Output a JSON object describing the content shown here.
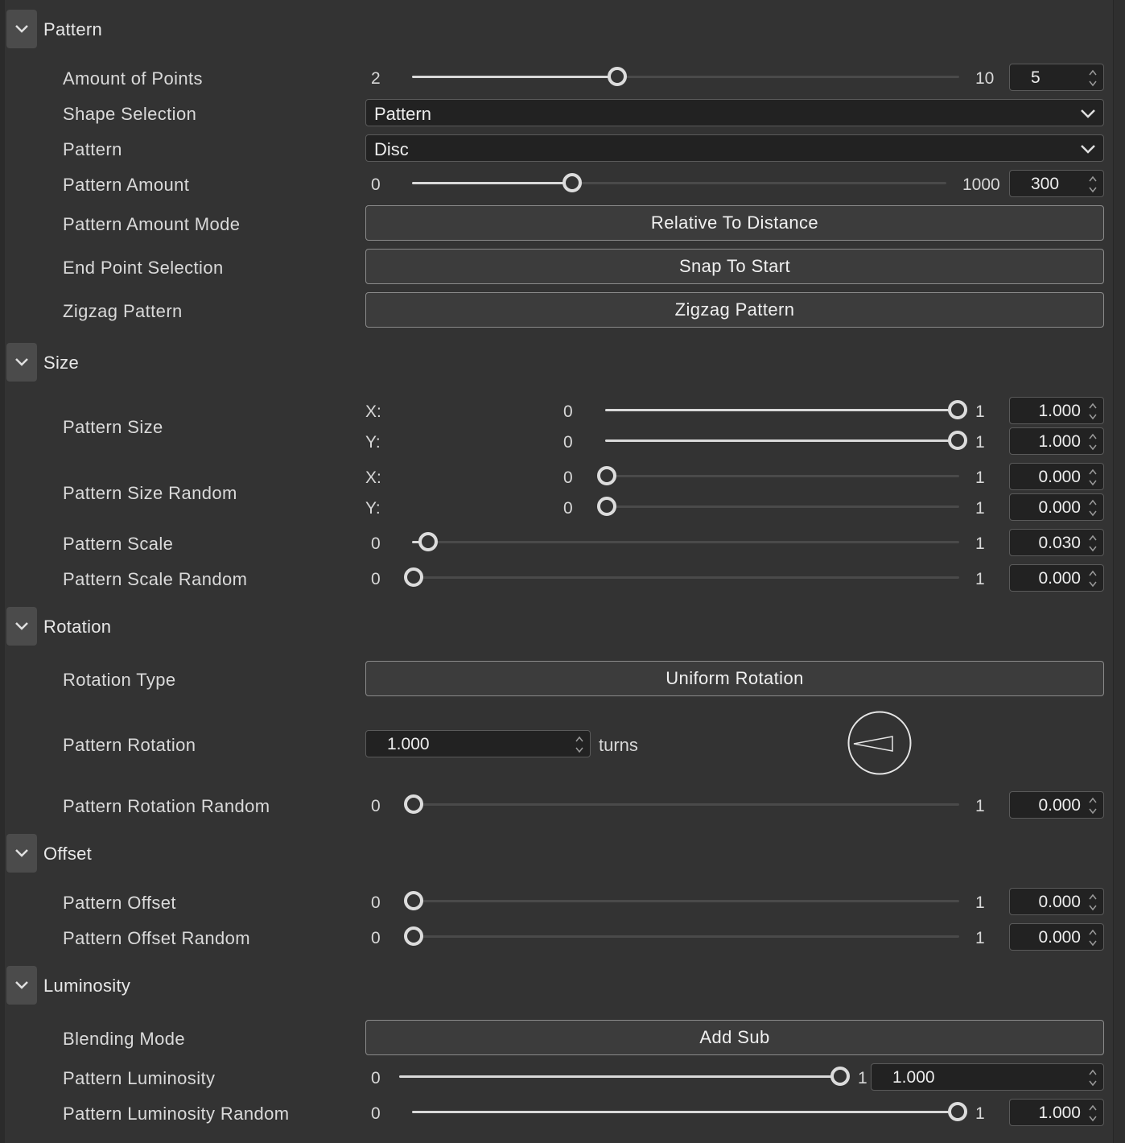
{
  "sections": {
    "pattern": {
      "title": "Pattern",
      "amount_of_points": {
        "label": "Amount of Points",
        "min": "2",
        "max": "10",
        "value": "5",
        "fraction": 0.375
      },
      "shape_selection": {
        "label": "Shape Selection",
        "value": "Pattern"
      },
      "pattern": {
        "label": "Pattern",
        "value": "Disc"
      },
      "pattern_amount": {
        "label": "Pattern Amount",
        "min": "0",
        "max": "1000",
        "value": "300",
        "fraction": 0.3
      },
      "pattern_amount_mode": {
        "label": "Pattern Amount Mode",
        "value": "Relative To Distance"
      },
      "end_point_selection": {
        "label": "End Point Selection",
        "value": "Snap To Start"
      },
      "zigzag_pattern": {
        "label": "Zigzag Pattern",
        "value": "Zigzag Pattern"
      }
    },
    "size": {
      "title": "Size",
      "pattern_size": {
        "label": "Pattern Size",
        "x": {
          "axis": "X:",
          "min": "0",
          "max": "1",
          "value": "1.000",
          "fraction": 1.0
        },
        "y": {
          "axis": "Y:",
          "min": "0",
          "max": "1",
          "value": "1.000",
          "fraction": 1.0
        }
      },
      "pattern_size_random": {
        "label": "Pattern Size Random",
        "x": {
          "axis": "X:",
          "min": "0",
          "max": "1",
          "value": "0.000",
          "fraction": 0.0
        },
        "y": {
          "axis": "Y:",
          "min": "0",
          "max": "1",
          "value": "0.000",
          "fraction": 0.0
        }
      },
      "pattern_scale": {
        "label": "Pattern Scale",
        "min": "0",
        "max": "1",
        "value": "0.030",
        "fraction": 0.03
      },
      "pattern_scale_random": {
        "label": "Pattern Scale Random",
        "min": "0",
        "max": "1",
        "value": "0.000",
        "fraction": 0.0
      }
    },
    "rotation": {
      "title": "Rotation",
      "rotation_type": {
        "label": "Rotation Type",
        "value": "Uniform Rotation"
      },
      "pattern_rotation": {
        "label": "Pattern Rotation",
        "value": "1.000",
        "unit": "turns"
      },
      "pattern_rotation_random": {
        "label": "Pattern Rotation Random",
        "min": "0",
        "max": "1",
        "value": "0.000",
        "fraction": 0.0
      }
    },
    "offset": {
      "title": "Offset",
      "pattern_offset": {
        "label": "Pattern Offset",
        "min": "0",
        "max": "1",
        "value": "0.000",
        "fraction": 0.0
      },
      "pattern_offset_random": {
        "label": "Pattern Offset Random",
        "min": "0",
        "max": "1",
        "value": "0.000",
        "fraction": 0.0
      }
    },
    "luminosity": {
      "title": "Luminosity",
      "blending_mode": {
        "label": "Blending Mode",
        "value": "Add Sub"
      },
      "pattern_luminosity": {
        "label": "Pattern Luminosity",
        "min": "0",
        "max": "1",
        "value": "1.000",
        "fraction": 1.0
      },
      "pattern_luminosity_random": {
        "label": "Pattern Luminosity Random",
        "min": "0",
        "max": "1",
        "value": "1.000",
        "fraction": 1.0
      }
    }
  },
  "colors": {
    "background": "#333333",
    "field": "#222222",
    "slider_fill": "#d9d9d9",
    "slider_track": "#4a4a4a"
  }
}
